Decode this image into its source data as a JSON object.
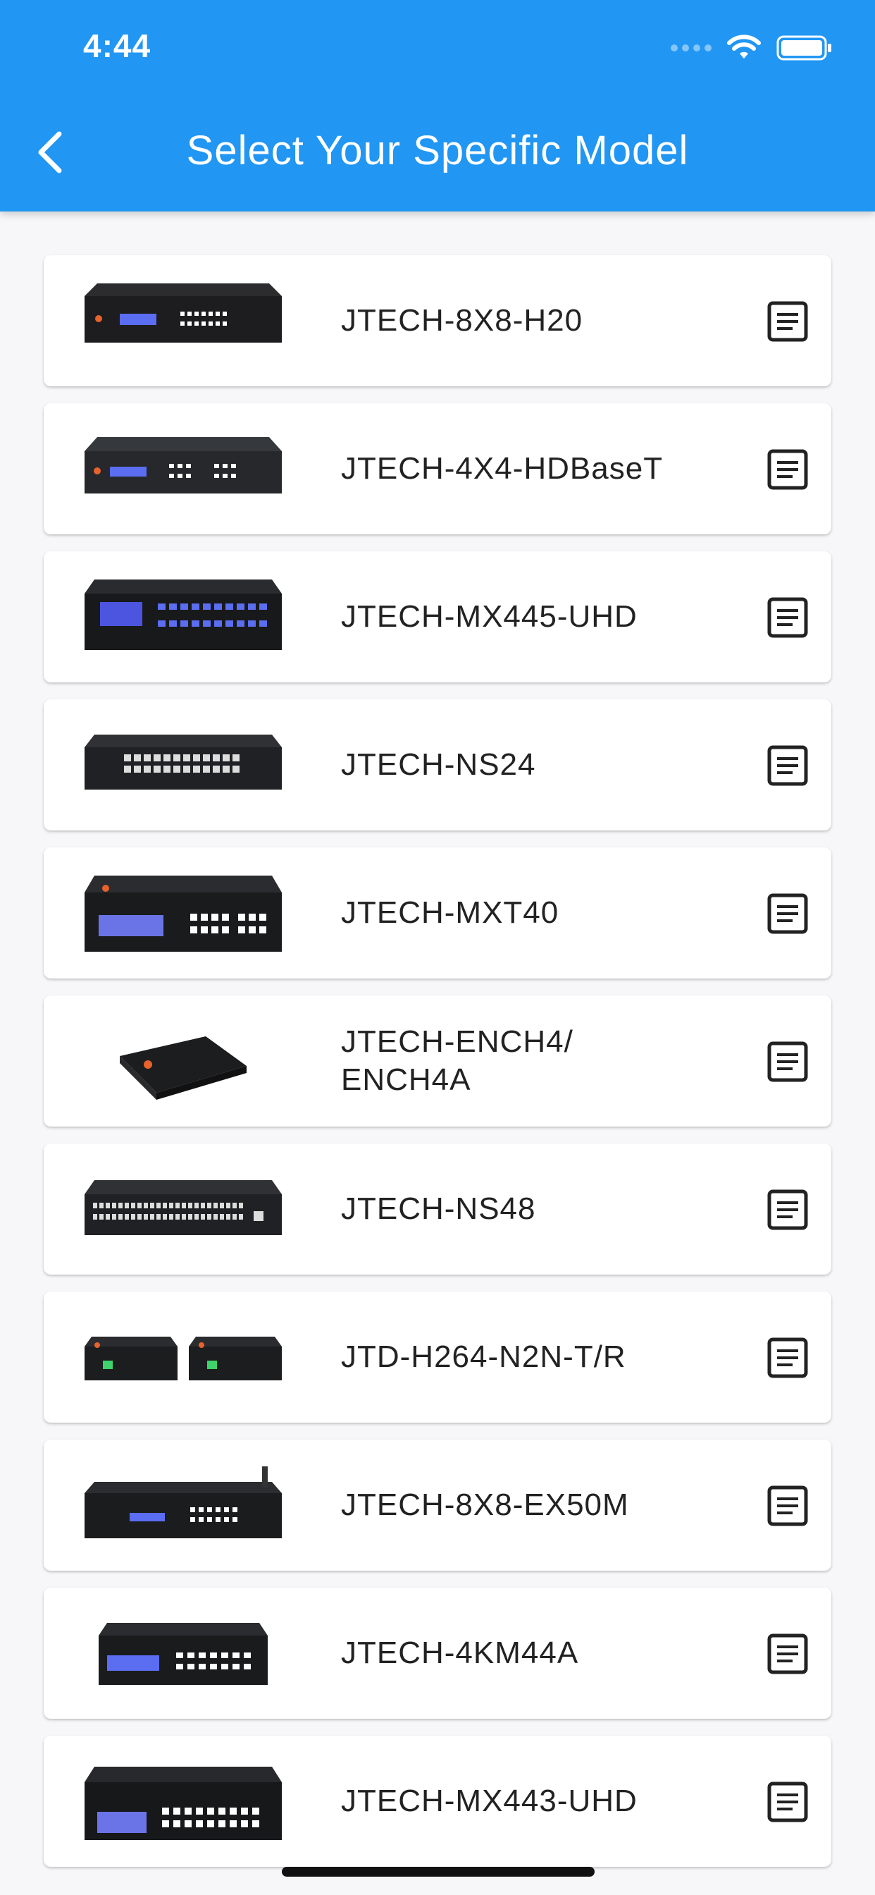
{
  "status_bar": {
    "time": "4:44"
  },
  "header": {
    "title": "Select Your Specific Model",
    "back_icon": "chevron-left-icon"
  },
  "colors": {
    "app_bar": "#2196f3",
    "background": "#f7f7f9",
    "card": "#ffffff",
    "text": "#222222"
  },
  "models": [
    {
      "name": "JTECH-8X8-H20",
      "image": "matrix-switcher-image",
      "icon": "document-icon"
    },
    {
      "name": "JTECH-4X4-HDBaseT",
      "image": "matrix-switcher-image",
      "icon": "document-icon"
    },
    {
      "name": "JTECH-MX445-UHD",
      "image": "matrix-switcher-image",
      "icon": "document-icon"
    },
    {
      "name": "JTECH-NS24",
      "image": "network-switch-image",
      "icon": "document-icon"
    },
    {
      "name": "JTECH-MXT40",
      "image": "matrix-switcher-image",
      "icon": "document-icon"
    },
    {
      "name": "JTECH-ENCH4/\nENCH4A",
      "image": "encoder-image",
      "icon": "document-icon"
    },
    {
      "name": "JTECH-NS48",
      "image": "network-switch-image",
      "icon": "document-icon"
    },
    {
      "name": "JTD-H264-N2N-T/R",
      "image": "transmitter-receiver-image",
      "icon": "document-icon"
    },
    {
      "name": "JTECH-8X8-EX50M",
      "image": "matrix-switcher-image",
      "icon": "document-icon"
    },
    {
      "name": "JTECH-4KM44A",
      "image": "matrix-switcher-image",
      "icon": "document-icon"
    },
    {
      "name": "JTECH-MX443-UHD",
      "image": "matrix-switcher-image",
      "icon": "document-icon"
    }
  ]
}
